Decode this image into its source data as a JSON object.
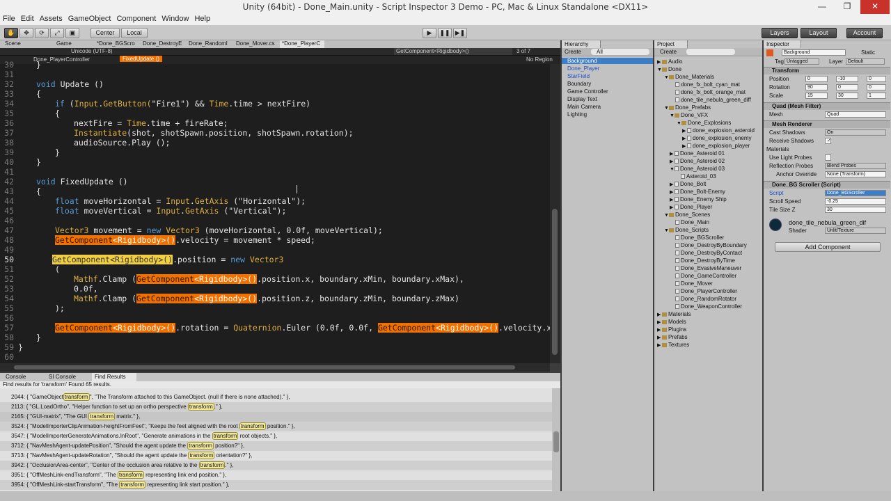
{
  "window": {
    "title": "Unity (64bit) - Done_Main.unity - Script Inspector 3 Demo - PC, Mac & Linux Standalone <DX11>",
    "controls": [
      "—",
      "❐",
      "✕"
    ]
  },
  "menu": [
    "File",
    "Edit",
    "Assets",
    "GameObject",
    "Component",
    "Window",
    "Help"
  ],
  "toolbar": {
    "center": "Center",
    "local": "Local",
    "layers": "Layers",
    "layout": "Layout",
    "account": "Account"
  },
  "editor": {
    "tabs": [
      "Scene",
      "Game",
      "*Done_BGScro",
      "Done_DestroyE",
      "Done_Randoml",
      "Done_Mover.cs",
      "*Done_PlayerC"
    ],
    "encoding": "Unicode (UTF-8)",
    "search_text": "GetComponent<Rigidbody>()",
    "search_count": "3 of 7",
    "breadcrumb_class": "Done_PlayerController",
    "breadcrumb_method": "FixedUpdate ()",
    "region": "No Region"
  },
  "code": {
    "l30": "30",
    "l31": "31",
    "l32": "32",
    "l33": "33",
    "l34": "34",
    "l35": "35",
    "l36": "36",
    "l37": "37",
    "l38": "38",
    "l39": "39",
    "l40": "40",
    "l41": "41",
    "l42": "42",
    "l43": "43",
    "l44": "44",
    "l45": "45",
    "l46": "46",
    "l47": "47",
    "l48": "48",
    "l49": "49",
    "l50": "50",
    "l51": "51",
    "l52": "52",
    "l53": "53",
    "l54": "54",
    "l55": "55",
    "l56": "56",
    "l57": "57",
    "l58": "58",
    "l59": "59",
    "l60": "60",
    "void": "void",
    "update": "Update ()",
    "fixedupdate": "FixedUpdate ()",
    "if": "if",
    "input": "Input",
    "getbutton": "GetButton(",
    "fire1": "\"Fire1\"",
    "and": ") &&",
    "time": "Time",
    "time_cond": ".time > nextFire)",
    "nextfire": "nextFire = ",
    "fr": ".time + fireRate;",
    "instantiate": "Instantiate",
    "inst_args": "(shot, shotSpawn.position, shotSpawn.rotation);",
    "audio": "audioSource.Play ();",
    "float": "float",
    "mh": "moveHorizontal = ",
    "getaxis": "GetAxis",
    "horiz": " (\"Horizontal\");",
    "mv": "moveVertical = ",
    "vert": " (\"Vertical\");",
    "vector3": "Vector3",
    "new": "new",
    "movement": " movement = ",
    "mov_args": " (moveHorizontal, 0.0f, moveVertical);",
    "getcomp": "GetComponent",
    "rb": "<Rigidbody>()",
    "velocity": ".velocity = movement * speed;",
    "position": ".position = ",
    "mathf": "Mathf",
    "clamp": ".Clamp (",
    "clamp_x": ".position.x, boundary.xMin, boundary.xMax),",
    "zero": "0.0f,",
    "clamp_z": ".position.z, boundary.zMin, boundary.zMax)",
    "close_paren": ");",
    "rotation": ".rotation = ",
    "quat": "Quaternion",
    "euler": ".Euler (0.0f, 0.0f, ",
    "vel_tail": ".velocity.x * -",
    "open": "{",
    "close": "}",
    "close_top": "}"
  },
  "console": {
    "tabs": [
      "Console",
      "SI Console",
      "Find Results"
    ],
    "find_header": "Find results for 'transform'   Found 65 results.",
    "rows": [
      {
        "pre": "2044: { \"GameObject",
        "word": "transform",
        "post": "\", \"The Transform attached to this GameObject. (null if there is none attached).\" },"
      },
      {
        "pre": "2113: { \"GL.LoadOrtho\", \"Helper function to set up an ortho perspective ",
        "word": "transform",
        "post": ".\" },"
      },
      {
        "pre": "2165: { \"GUI-matrix\", \"The GUI ",
        "word": "transform",
        "post": " matrix.\" },"
      },
      {
        "pre": "3524: { \"ModelImporterClipAnimation-heightFromFeet\", \"Keeps the feet aligned with the root ",
        "word": "transform",
        "post": " position.\" },"
      },
      {
        "pre": "3547: { \"ModelImporterGenerateAnimations.InRoot\", \"Generate animations in the ",
        "word": "transform",
        "post": " root objects.\" },"
      },
      {
        "pre": "3712: { \"NavMeshAgent-updatePosition\", \"Should the agent update the ",
        "word": "transform",
        "post": " position?\" },"
      },
      {
        "pre": "3713: { \"NavMeshAgent-updateRotation\", \"Should the agent update the ",
        "word": "transform",
        "post": " orientation?\" },"
      },
      {
        "pre": "3942: { \"OcclusionArea-center\", \"Center of the occlusion area relative to the ",
        "word": "transform",
        "post": ".\" },"
      },
      {
        "pre": "3951: { \"OffMeshLink-endTransform\", \"The ",
        "word": "transform",
        "post": " representing link end position.\" },"
      },
      {
        "pre": "3954: { \"OffMeshLink-startTransform\", \"The ",
        "word": "transform",
        "post": " representing link start position.\" },"
      }
    ]
  },
  "hierarchy": {
    "title": "Hierarchy",
    "create": "Create",
    "search": "All",
    "items": [
      "Background",
      "Done_Player",
      "StarField",
      "Boundary",
      "Game Controller",
      "Display Text",
      "Main Camera",
      "Lighting"
    ]
  },
  "project": {
    "title": "Project",
    "create": "Create",
    "items": [
      "Audio",
      "Done",
      "Done_Materials",
      "done_fx_bolt_cyan_mat",
      "done_fx_bolt_orange_mat",
      "done_tile_nebula_green_diff",
      "Done_Prefabs",
      "Done_VFX",
      "Done_Explosions",
      "done_explosion_asteroid",
      "done_explosion_enemy",
      "done_explosion_player",
      "Done_Asteroid 01",
      "Done_Asteroid 02",
      "Done_Asteroid 03",
      "Asteroid_03",
      "Done_Bolt",
      "Done_Bolt-Enemy",
      "Done_Enemy Ship",
      "Done_Player",
      "Done_Scenes",
      "Done_Main",
      "Done_Scripts",
      "Done_BGScroller",
      "Done_DestroyByBoundary",
      "Done_DestroyByContact",
      "Done_DestroyByTime",
      "Done_EvasiveManeuver",
      "Done_GameController",
      "Done_Mover",
      "Done_PlayerController",
      "Done_RandomRotator",
      "Done_WeaponController",
      "Materials",
      "Models",
      "Plugins",
      "Prefabs",
      "Textures"
    ]
  },
  "inspector": {
    "title": "Inspector",
    "object_name": "Background",
    "static": "Static",
    "tag_label": "Tag",
    "tag_value": "Untagged",
    "layer_label": "Layer",
    "layer_value": "Default",
    "transform": "Transform",
    "position": "Position",
    "rotation": "Rotation",
    "scale": "Scale",
    "pos": {
      "x": "0",
      "y": "-10",
      "z": "0"
    },
    "rot": {
      "x": "90",
      "y": "0",
      "z": "0"
    },
    "scl": {
      "x": "15",
      "y": "30",
      "z": "1"
    },
    "mesh_filter": "Quad (Mesh Filter)",
    "mesh_label": "Mesh",
    "mesh_value": "Quad",
    "mesh_renderer": "Mesh Renderer",
    "cast_shadows": "Cast Shadows",
    "cast_value": "On",
    "receive_shadows": "Receive Shadows",
    "materials": "Materials",
    "use_light_probes": "Use Light Probes",
    "reflection_probes": "Reflection Probes",
    "refl_value": "Blend Probes",
    "anchor_override": "Anchor Override",
    "anchor_value": "None (Transform)",
    "bg_scroller": "Done_BG Scroller (Script)",
    "script_label": "Script",
    "script_value": "Done_BGScroller",
    "scroll_speed": "Scroll Speed",
    "scroll_value": "-0.25",
    "tile_size": "Tile Size Z",
    "tile_value": "30",
    "material_name": "done_tile_nebula_green_dif",
    "shader_label": "Shader",
    "shader_value": "Unlit/Texture",
    "add_component": "Add Component"
  }
}
